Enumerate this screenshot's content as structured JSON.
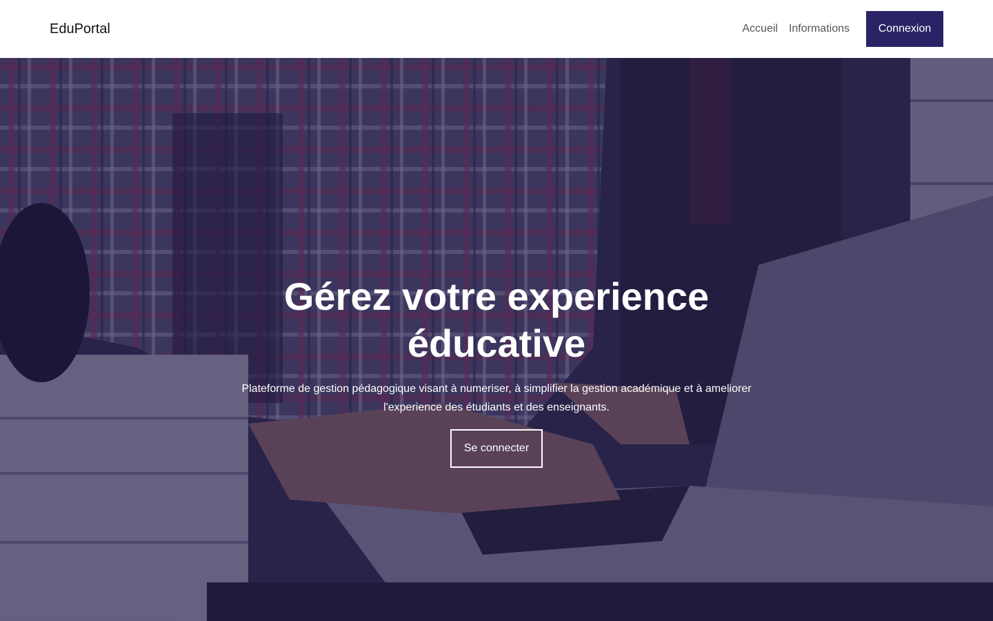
{
  "nav": {
    "brand": "EduPortal",
    "links": [
      "Accueil",
      "Informations"
    ],
    "login_label": "Connexion"
  },
  "hero": {
    "title": "Gérez votre experience éducative",
    "subtitle": "Plateforme de gestion pédagogique visant à numeriser, à simplifier la gestion académique et à ameliorer l'experience des étudiants et des enseignants.",
    "cta_label": "Se connecter",
    "background_image": "student-typing-on-laptop-with-books"
  },
  "colors": {
    "primary": "#2a2365",
    "overlay": "#1e1646"
  }
}
